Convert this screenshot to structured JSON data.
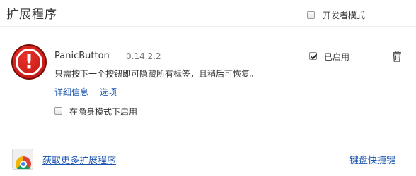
{
  "header": {
    "title": "扩展程序",
    "developer_mode": {
      "label": "开发者模式",
      "checked": false
    }
  },
  "extension": {
    "icon": "panic-button-exclamation-icon",
    "name": "PanicButton",
    "version": "0.14.2.2",
    "description": "只需按下一个按钮即可隐藏所有标签，且稍后可恢复。",
    "details_link": "详细信息",
    "options_link": "选项",
    "enabled": {
      "label": "已启用",
      "checked": true
    },
    "remove_icon": "trash-icon",
    "incognito": {
      "label": "在隐身模式下启用",
      "checked": false
    }
  },
  "footer": {
    "store_icon": "chrome-web-store-icon",
    "more_extensions_link": "获取更多扩展程序",
    "keyboard_shortcuts_link": "键盘快捷键"
  },
  "colors": {
    "link": "#1a55b0",
    "icon_red": "#c81d17"
  }
}
